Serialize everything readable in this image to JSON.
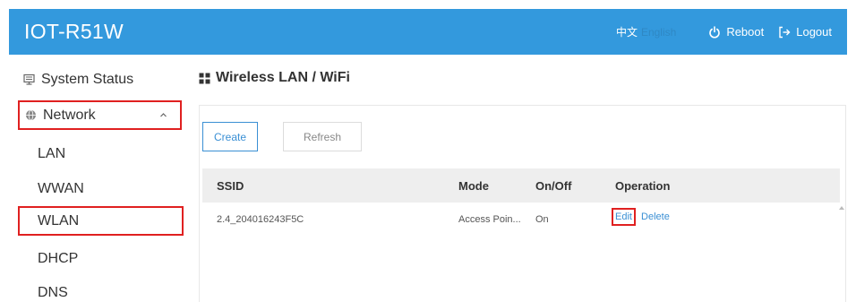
{
  "header": {
    "title": "IOT-R51W",
    "lang_zh": "中文",
    "lang_en": "English",
    "reboot_label": "Reboot",
    "logout_label": "Logout"
  },
  "sidebar": {
    "items": [
      {
        "label": "System Status",
        "icon": "monitor-icon"
      },
      {
        "label": "Network",
        "icon": "globe-icon",
        "expanded": true
      },
      {
        "label": "LAN"
      },
      {
        "label": "WWAN"
      },
      {
        "label": "WLAN",
        "highlighted": true
      },
      {
        "label": "DHCP"
      },
      {
        "label": "DNS"
      }
    ]
  },
  "main": {
    "title": "Wireless LAN / WiFi",
    "buttons": {
      "create": "Create",
      "refresh": "Refresh"
    },
    "table": {
      "columns": [
        "SSID",
        "Mode",
        "On/Off",
        "Operation"
      ],
      "rows": [
        {
          "ssid": "2.4_204016243F5C",
          "mode": "Access Poin...",
          "onoff": "On",
          "edit": "Edit",
          "delete": "Delete"
        }
      ]
    }
  },
  "colors": {
    "header_bg": "#3399dd",
    "accent": "#3a8fd4",
    "highlight_border": "#e02020"
  }
}
